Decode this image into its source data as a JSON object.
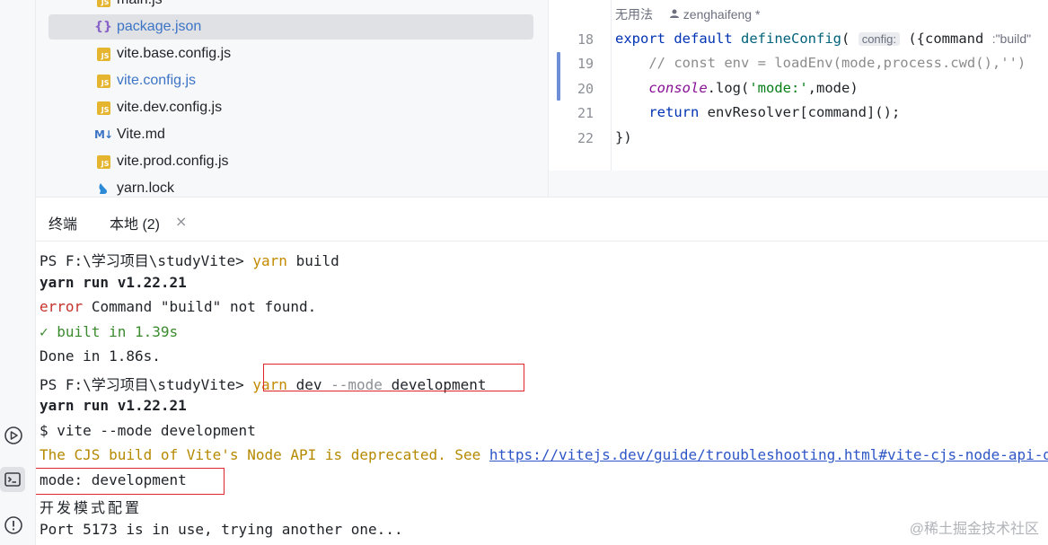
{
  "project_tree": {
    "items": [
      {
        "label": "main.js",
        "icon": "js-file-icon",
        "selected": false
      },
      {
        "label": "package.json",
        "icon": "json-file-icon",
        "selected": true
      },
      {
        "label": "vite.base.config.js",
        "icon": "js-file-icon",
        "selected": false
      },
      {
        "label": "vite.config.js",
        "icon": "js-file-icon",
        "selected": false,
        "color": "#3d74c5"
      },
      {
        "label": "vite.dev.config.js",
        "icon": "js-file-icon",
        "selected": false
      },
      {
        "label": "Vite.md",
        "icon": "markdown-file-icon",
        "selected": false
      },
      {
        "label": "vite.prod.config.js",
        "icon": "js-file-icon",
        "selected": false
      },
      {
        "label": "yarn.lock",
        "icon": "yarn-lock-icon",
        "selected": false
      }
    ],
    "icon_glyphs": {
      "js": "JS",
      "json": "{}",
      "md": "M↓",
      "lock": "🧶"
    }
  },
  "editor": {
    "inlay": {
      "usages": "无用法",
      "author": "zenghaifeng *"
    },
    "line_numbers": [
      "18",
      "19",
      "20",
      "21",
      "22"
    ],
    "line18": {
      "kw_export": "export",
      "kw_default": "default",
      "fn_name": "defineConfig",
      "open_paren": "(",
      "param_hint": "config:",
      "args": "({command",
      "type_hint": ":\"build\""
    },
    "line19": {
      "comment": "// const env = loadEnv(mode,process.cwd(),'')"
    },
    "line20": {
      "obj": "console",
      "method": ".log(",
      "str": "'mode:'",
      "rest": ",mode)"
    },
    "line21": {
      "kw_return": "return",
      "rest": "envResolver[command]();"
    },
    "line22": {
      "text": "})"
    }
  },
  "terminal": {
    "title": "终端",
    "tab_label": "本地 (2)",
    "close_glyph": "×",
    "lines": {
      "l1_prompt": "PS F:\\学习项目\\studyVite>",
      "l1_cmd": "yarn",
      "l1_arg": "build",
      "l2": "yarn run v1.22.21",
      "l3_err": "error",
      "l3_rest": "Command \"build\" not found.",
      "l4": "✓ built in 1.39s",
      "l5": "Done in 1.86s.",
      "l6_prompt": "PS F:\\学习项目\\studyVite>",
      "l6_cmd": "yarn",
      "l6_dev": "dev",
      "l6_flag": "--mode",
      "l6_val": "development",
      "l7": "yarn run v1.22.21",
      "l8": "$ vite --mode development",
      "l9_warn": "The CJS build of Vite's Node API is deprecated. See",
      "l9_link": "https://vitejs.dev/guide/troubleshooting.html#vite-cjs-node-api-deprecated",
      "l10": "mode: development",
      "l11": "开发模式配置",
      "l12": "Port 5173 is in use, trying another one..."
    }
  },
  "watermark": "@稀土掘金技术社区",
  "colors": {
    "highlight_box": "#e0262b",
    "accent_blue": "#3d74c5",
    "terminal_command": "#c38a00",
    "terminal_error": "#c4322b",
    "terminal_success": "#3b8a2e"
  },
  "side_icons": [
    "run-icon",
    "terminal-icon",
    "problems-icon"
  ]
}
